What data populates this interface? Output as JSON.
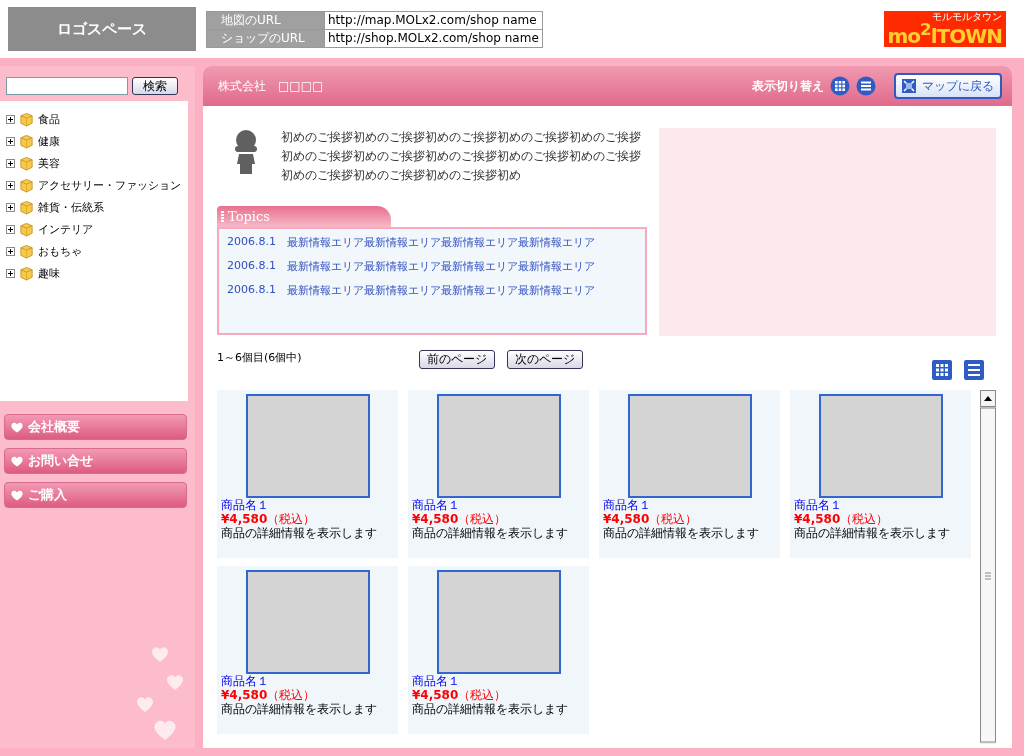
{
  "header": {
    "logo_space": "ロゴスペース",
    "urls": [
      {
        "label": "地図のURL",
        "value": "http://map.MOLx2.com/shop name"
      },
      {
        "label": "ショップのURL",
        "value": "http://shop.MOLx2.com/shop name"
      }
    ],
    "brand": {
      "name": "mo$^{2}$lTOWN",
      "tagline": "モルモルタウン"
    }
  },
  "search": {
    "button": "検索"
  },
  "categories": [
    {
      "label": "食品",
      "expanded": false
    },
    {
      "label": "健康",
      "expanded": false
    },
    {
      "label": "美容",
      "expanded": false
    },
    {
      "label": "アクセサリー・ファッション",
      "expanded": false
    },
    {
      "label": "雑貨・伝統系",
      "expanded": false
    },
    {
      "label": "インテリア",
      "expanded": false
    },
    {
      "label": "おもちゃ",
      "expanded": false
    },
    {
      "label": "趣味",
      "expanded": false
    }
  ],
  "side_menu": [
    "会社概要",
    "お問い合せ",
    "ご購入"
  ],
  "shop_bar": {
    "company": "株式会社　□□□□",
    "view_switch": "表示切り替え",
    "back_button": "マップに戻る"
  },
  "greeting": "初めのご挨拶初めのご挨拶初めのご挨拶初めのご挨拶初めのご挨拶初めのご挨拶初めのご挨拶初めのご挨拶初めのご挨拶初めのご挨拶初めのご挨拶初めのご挨拶初めのご挨拶初め",
  "topics": {
    "title": "Topics",
    "items": [
      {
        "date": "2006.8.1",
        "text": "最新情報エリア最新情報エリア最新情報エリア最新情報エリア"
      },
      {
        "date": "2006.8.1",
        "text": "最新情報エリア最新情報エリア最新情報エリア最新情報エリア"
      },
      {
        "date": "2006.8.1",
        "text": "最新情報エリア最新情報エリア最新情報エリア最新情報エリア"
      }
    ]
  },
  "pagination": {
    "count": "1～6個目(6個中)",
    "prev": "前のページ",
    "next": "次のページ"
  },
  "products": [
    {
      "name": "商品名１",
      "price": "¥4,580",
      "tax": "（税込）",
      "description": "商品の詳細情報を表示します"
    },
    {
      "name": "商品名１",
      "price": "¥4,580",
      "tax": "（税込）",
      "description": "商品の詳細情報を表示します"
    },
    {
      "name": "商品名１",
      "price": "¥4,580",
      "tax": "（税込）",
      "description": "商品の詳細情報を表示します"
    },
    {
      "name": "商品名１",
      "price": "¥4,580",
      "tax": "（税込）",
      "description": "商品の詳細情報を表示します"
    },
    {
      "name": "商品名１",
      "price": "¥4,580",
      "tax": "（税込）",
      "description": "商品の詳細情報を表示します"
    },
    {
      "name": "商品名１",
      "price": "¥4,580",
      "tax": "（税込）",
      "description": "商品の詳細情報を表示します"
    }
  ]
}
